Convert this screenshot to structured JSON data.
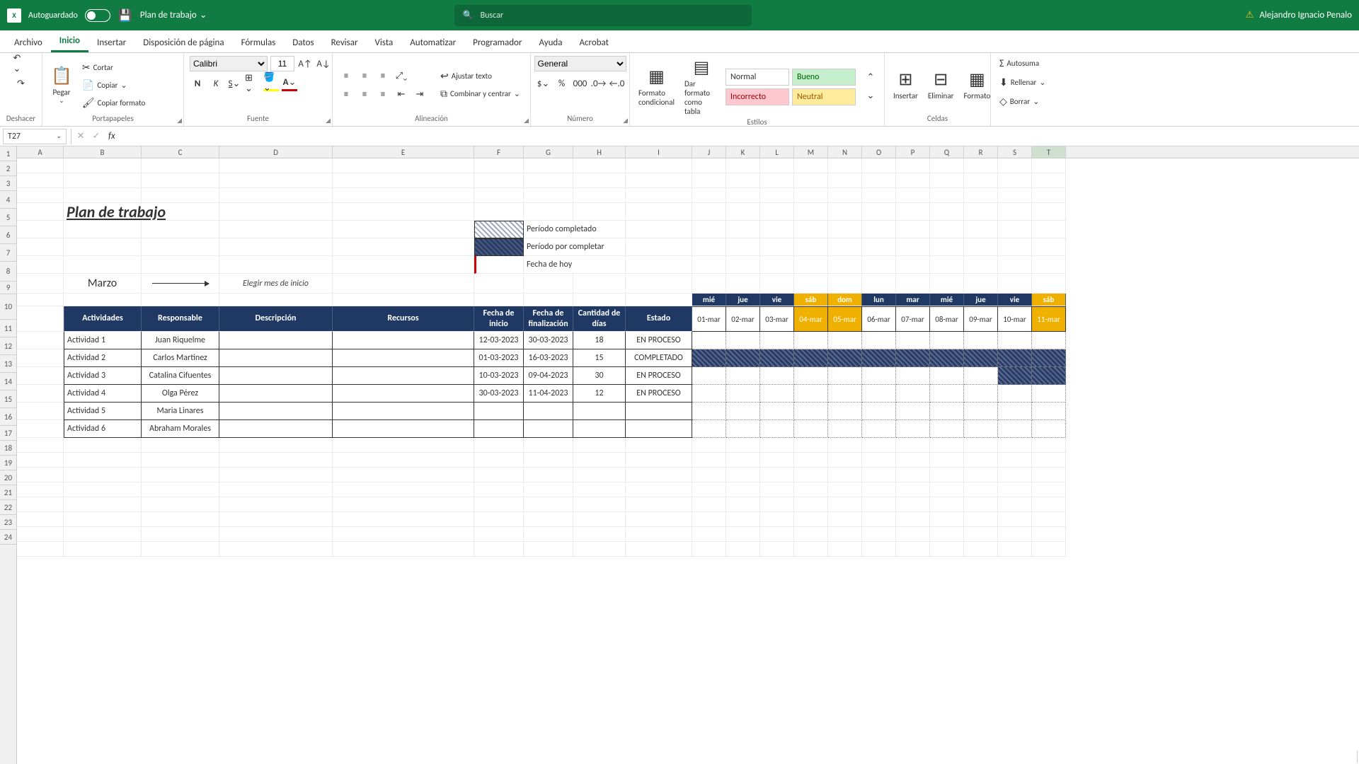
{
  "titlebar": {
    "autosave": "Autoguardado",
    "doc": "Plan de trabajo",
    "search_placeholder": "Buscar",
    "user": "Alejandro Ignacio Penalo"
  },
  "tabs": [
    "Archivo",
    "Inicio",
    "Insertar",
    "Disposición de página",
    "Fórmulas",
    "Datos",
    "Revisar",
    "Vista",
    "Automatizar",
    "Programador",
    "Ayuda",
    "Acrobat"
  ],
  "active_tab": 1,
  "ribbon": {
    "undo": "Deshacer",
    "clipboard": {
      "label": "Portapapeles",
      "paste": "Pegar",
      "cut": "Cortar",
      "copy": "Copiar",
      "fmtpaint": "Copiar formato"
    },
    "font": {
      "label": "Fuente",
      "name": "Calibri",
      "size": "11"
    },
    "align": {
      "label": "Alineación",
      "wrap": "Ajustar texto",
      "merge": "Combinar y centrar"
    },
    "number": {
      "label": "Número",
      "format": "General"
    },
    "styles": {
      "label": "Estilos",
      "cond": "Formato condicional",
      "table": "Dar formato como tabla",
      "normal": "Normal",
      "bueno": "Bueno",
      "incorrecto": "Incorrecto",
      "neutral": "Neutral"
    },
    "cells": {
      "label": "Celdas",
      "insert": "Insertar",
      "delete": "Eliminar",
      "format": "Formato"
    },
    "edit": {
      "autosum": "Autosuma",
      "fill": "Rellenar",
      "clear": "Borrar"
    }
  },
  "namebox": "T27",
  "sheet": {
    "title": "Plan de trabajo",
    "month": "Marzo",
    "month_hint": "Elegir mes de inicio",
    "legend": {
      "done": "Período completado",
      "todo": "Período por completar",
      "today": "Fecha de hoy"
    },
    "headers": {
      "act": "Actividades",
      "resp": "Responsable",
      "desc": "Descripción",
      "rec": "Recursos",
      "start": "Fecha de inicio",
      "end": "Fecha de finalización",
      "days": "Cantidad de días",
      "status": "Estado"
    },
    "days": [
      "mié",
      "jue",
      "vie",
      "sáb",
      "dom",
      "lun",
      "mar",
      "mié",
      "jue",
      "vie",
      "sáb"
    ],
    "dates": [
      "01-mar",
      "02-mar",
      "03-mar",
      "04-mar",
      "05-mar",
      "06-mar",
      "07-mar",
      "08-mar",
      "09-mar",
      "10-mar",
      "11-mar"
    ],
    "weekend_idx": [
      3,
      4,
      10
    ],
    "rows": [
      {
        "act": "Actividad 1",
        "resp": "Juan Riquelme",
        "start": "12-03-2023",
        "end": "30-03-2023",
        "days": "18",
        "status": "EN PROCESO",
        "gantt": [
          0,
          0,
          0,
          0,
          0,
          0,
          0,
          0,
          0,
          0,
          0
        ]
      },
      {
        "act": "Actividad 2",
        "resp": "Carlos Martinez",
        "start": "01-03-2023",
        "end": "16-03-2023",
        "days": "15",
        "status": "COMPLETADO",
        "gantt": [
          1,
          1,
          1,
          1,
          1,
          1,
          1,
          1,
          1,
          1,
          1
        ]
      },
      {
        "act": "Actividad 3",
        "resp": "Catalina Cifuentes",
        "start": "10-03-2023",
        "end": "09-04-2023",
        "days": "30",
        "status": "EN PROCESO",
        "gantt": [
          0,
          0,
          0,
          0,
          0,
          0,
          0,
          0,
          0,
          1,
          1
        ]
      },
      {
        "act": "Actividad 4",
        "resp": "Olga Pérez",
        "start": "30-03-2023",
        "end": "11-04-2023",
        "days": "12",
        "status": "EN PROCESO",
        "gantt": [
          0,
          0,
          0,
          0,
          0,
          0,
          0,
          0,
          0,
          0,
          0
        ]
      },
      {
        "act": "Actividad 5",
        "resp": "Maria Linares",
        "start": "",
        "end": "",
        "days": "",
        "status": "",
        "gantt": [
          0,
          0,
          0,
          0,
          0,
          0,
          0,
          0,
          0,
          0,
          0
        ]
      },
      {
        "act": "Actividad 6",
        "resp": "Abraham Morales",
        "start": "",
        "end": "",
        "days": "",
        "status": "",
        "gantt": [
          0,
          0,
          0,
          0,
          0,
          0,
          0,
          0,
          0,
          0,
          0
        ]
      }
    ]
  },
  "cols": [
    "A",
    "B",
    "C",
    "D",
    "E",
    "F",
    "G",
    "H",
    "I",
    "J",
    "K",
    "L",
    "M",
    "N",
    "O",
    "P",
    "Q",
    "R",
    "S",
    "T"
  ]
}
